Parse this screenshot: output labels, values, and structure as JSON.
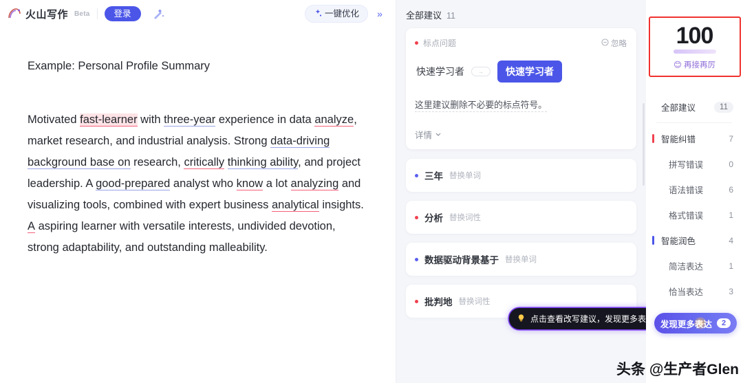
{
  "editor": {
    "brand": {
      "name": "火山写作",
      "beta": "Beta",
      "logo_icon": "volcano-logo-icon"
    },
    "login_label": "登录",
    "magic_icon": "magic-wand-icon",
    "optimize_label": "一键优化",
    "optimize_icon": "sparkle-icon",
    "collapse_icon": "chevron-double-right-icon",
    "doc_title": "Example: Personal Profile Summary",
    "paragraph": {
      "segments": [
        {
          "text": "Motivated ",
          "mark": "none"
        },
        {
          "text": "fast-learner",
          "mark": "highlight-red"
        },
        {
          "text": " with ",
          "mark": "none"
        },
        {
          "text": "three-year",
          "mark": "blue"
        },
        {
          "text": " experience in data ",
          "mark": "none"
        },
        {
          "text": "analyze",
          "mark": "red"
        },
        {
          "text": ", market research, and industrial analysis. Strong ",
          "mark": "none"
        },
        {
          "text": "data-driving background base on",
          "mark": "blue"
        },
        {
          "text": " research, ",
          "mark": "none"
        },
        {
          "text": "critically",
          "mark": "red"
        },
        {
          "text": " ",
          "mark": "none"
        },
        {
          "text": "thinking ability",
          "mark": "blue"
        },
        {
          "text": ", and project leadership. A ",
          "mark": "none"
        },
        {
          "text": "good-prepared",
          "mark": "blue"
        },
        {
          "text": " analyst who ",
          "mark": "none"
        },
        {
          "text": "know",
          "mark": "red"
        },
        {
          "text": " a lot ",
          "mark": "none"
        },
        {
          "text": "analyzing",
          "mark": "red"
        },
        {
          "text": " and visualizing tools, combined with expert business ",
          "mark": "none"
        },
        {
          "text": "analytical",
          "mark": "red"
        },
        {
          "text": " insights. ",
          "mark": "none"
        },
        {
          "text": "A",
          "mark": "red"
        },
        {
          "text": " aspiring learner with versatile interests, undivided devotion, strong adaptability, and outstanding malleability.",
          "mark": "none"
        }
      ]
    }
  },
  "suggestions": {
    "header_title": "全部建议",
    "header_count": "11",
    "card": {
      "dot_color": "red",
      "tag": "标点问题",
      "ignore_label": "忽略",
      "ignore_icon": "circle-minus-icon",
      "replace_from": "快速学习者",
      "arrow_icon": "arrow-right-pill-icon",
      "replace_to": "快速学习者",
      "description": "这里建议删除不必要的标点符号。",
      "detail_label": "详情",
      "detail_icon": "chevron-down-icon"
    },
    "items": [
      {
        "dot_color": "blue",
        "word": "三年",
        "action": "替换单词"
      },
      {
        "dot_color": "red",
        "word": "分析",
        "action": "替换词性"
      },
      {
        "dot_color": "blue",
        "word": "数据驱动背景基于",
        "action": "替换单词"
      },
      {
        "dot_color": "red",
        "word": "批判地",
        "action": "替换词性"
      }
    ],
    "tooltip": {
      "icon": "lightbulb-icon",
      "text": "点击查看改写建议，发现更多表达"
    }
  },
  "right": {
    "score": {
      "value": "100",
      "caption": "再接再厉",
      "emoji": "😊",
      "highlight_color": "#f0312f"
    },
    "nav": [
      {
        "label": "全部建议",
        "count": "11",
        "level": "top",
        "bar": "none"
      },
      {
        "label": "智能纠错",
        "count": "7",
        "level": "group",
        "bar": "red"
      },
      {
        "label": "拼写错误",
        "count": "0",
        "level": "sub",
        "bar": "none"
      },
      {
        "label": "语法错误",
        "count": "6",
        "level": "sub",
        "bar": "none"
      },
      {
        "label": "格式错误",
        "count": "1",
        "level": "sub",
        "bar": "none"
      },
      {
        "label": "智能润色",
        "count": "4",
        "level": "group",
        "bar": "blue"
      },
      {
        "label": "简洁表达",
        "count": "1",
        "level": "sub",
        "bar": "none"
      },
      {
        "label": "恰当表达",
        "count": "3",
        "level": "sub",
        "bar": "none"
      }
    ],
    "more_button": {
      "label": "发现更多表达",
      "count": "2"
    }
  },
  "watermark": "头条 @生产者Glen"
}
